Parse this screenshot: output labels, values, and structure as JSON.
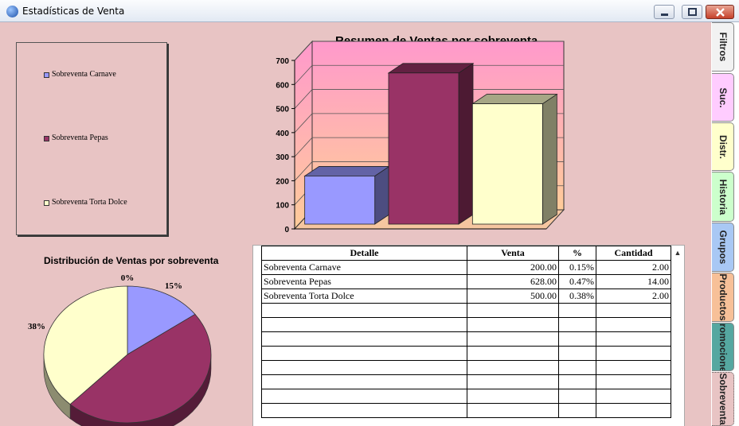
{
  "window": {
    "title": "Estadísticas de Venta"
  },
  "legend": {
    "items": [
      {
        "label": "Sobreventa Carnave",
        "color": "#9999ff"
      },
      {
        "label": "Sobreventa Pepas",
        "color": "#993366"
      },
      {
        "label": "Sobreventa Torta Dolce",
        "color": "#ffffcc"
      }
    ]
  },
  "bar_chart": {
    "title": "Resumen de Ventas por sobreventa"
  },
  "pie_chart": {
    "title": "Distribución de Ventas por sobreventa"
  },
  "chart_data": [
    {
      "type": "bar",
      "title": "Resumen de Ventas por sobreventa",
      "categories": [
        "Sobreventa Carnave",
        "Sobreventa Pepas",
        "Sobreventa Torta Dolce"
      ],
      "values": [
        200,
        628,
        500
      ],
      "colors": [
        "#9999ff",
        "#993366",
        "#ffffcc"
      ],
      "ylim": [
        0,
        700
      ],
      "yticks": [
        "0",
        "100",
        "200",
        "300",
        "400",
        "500",
        "600",
        "700"
      ],
      "grid": true,
      "three_d": true
    },
    {
      "type": "pie",
      "title": "Distribución de Ventas por sobreventa",
      "categories": [
        "Sobreventa Carnave",
        "Sobreventa Pepas",
        "Sobreventa Torta Dolce"
      ],
      "values": [
        15,
        47,
        38
      ],
      "labels": [
        "15%",
        "0%",
        "38%"
      ],
      "colors": [
        "#9999ff",
        "#993366",
        "#ffffcc"
      ],
      "three_d": true
    }
  ],
  "table": {
    "headers": [
      "Detalle",
      "Venta",
      "%",
      "Cantidad"
    ],
    "rows": [
      [
        "Sobreventa Carnave",
        "200.00",
        "0.15%",
        "2.00"
      ],
      [
        "Sobreventa Pepas",
        "628.00",
        "0.47%",
        "14.00"
      ],
      [
        "Sobreventa Torta Dolce",
        "500.00",
        "0.38%",
        "2.00"
      ]
    ],
    "empty_rows": 8
  },
  "tabs": [
    {
      "label": "Filtros",
      "color": "#f2f2f2"
    },
    {
      "label": "Suc.",
      "color": "#ffccff"
    },
    {
      "label": "Distr.",
      "color": "#ffffcc"
    },
    {
      "label": "Historia",
      "color": "#ccffcc"
    },
    {
      "label": "Grupos",
      "color": "#a9c8f4"
    },
    {
      "label": "Productos",
      "color": "#f7c098"
    },
    {
      "label": "Promociones",
      "color": "#55a7a0"
    },
    {
      "label": "Sobreventa",
      "color": "#e8c4c4"
    }
  ]
}
